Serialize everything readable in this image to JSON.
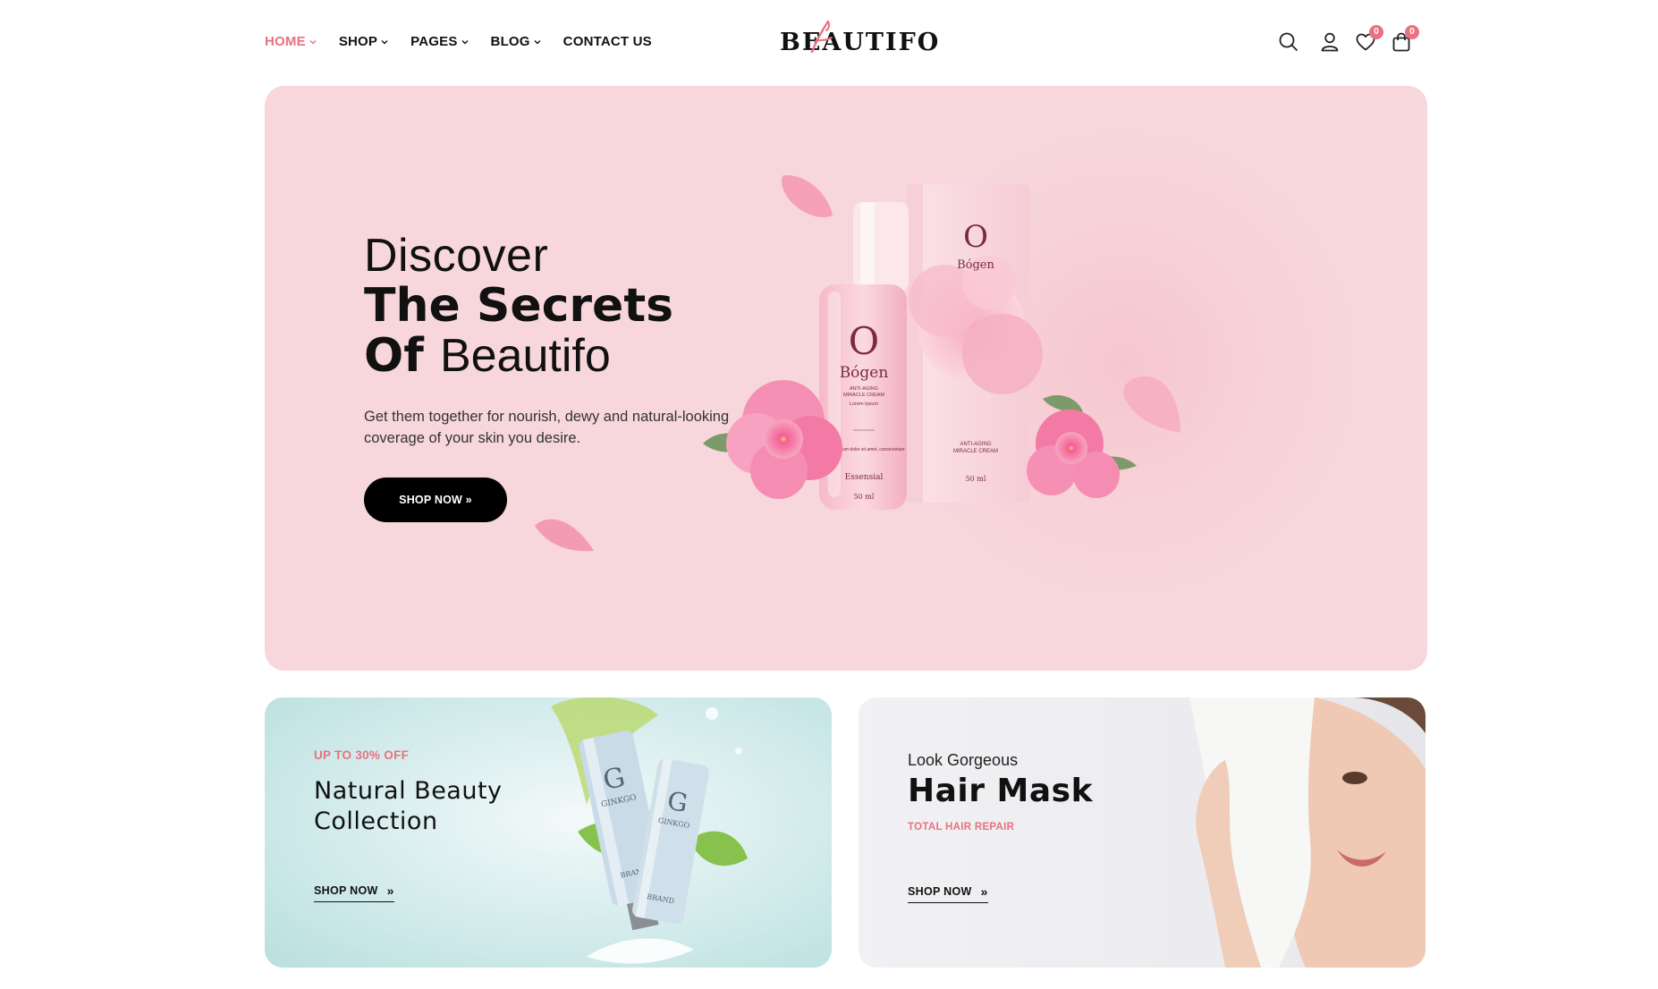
{
  "header": {
    "nav": [
      {
        "label": "HOME",
        "dropdown": true,
        "active": true
      },
      {
        "label": "SHOP",
        "dropdown": true,
        "active": false
      },
      {
        "label": "PAGES",
        "dropdown": true,
        "active": false
      },
      {
        "label": "BLOG",
        "dropdown": true,
        "active": false
      },
      {
        "label": "CONTACT US",
        "dropdown": false,
        "active": false
      }
    ],
    "logo": "BEAUTIFO",
    "wishlist_count": "0",
    "cart_count": "0",
    "icons": [
      "search-icon",
      "user-icon",
      "heart-icon",
      "bag-icon"
    ]
  },
  "hero": {
    "title_line1": "Discover",
    "title_line2": "The Secrets",
    "title_line3_bold": "Of",
    "title_line3_regular": "Beautifo",
    "description": "Get them together for nourish, dewy and natural-looking coverage of your skin you desire.",
    "cta": "SHOP NOW »",
    "product_brand": "Bógen",
    "product_letter": "O",
    "product_line1": "ANTI-AGING",
    "product_line2": "MIRACLE CREAM",
    "product_sub": "Lorem Ipsum",
    "product_fine": "Lorem ipsum dolor sit amet, consectetuer",
    "product_range": "Essensial",
    "product_volume": "50 ml"
  },
  "promos": [
    {
      "tag": "UP TO 30% OFF",
      "title_line1": "Natural Beauty",
      "title_line2": "Collection",
      "link": "SHOP NOW",
      "product_letter": "G",
      "product_name": "GINKGO",
      "product_brand": "BRAND"
    },
    {
      "kicker": "Look Gorgeous",
      "title": "Hair Mask",
      "tag": "TOTAL HAIR REPAIR",
      "link": "SHOP NOW"
    }
  ],
  "colors": {
    "accent": "#e8727f",
    "hero_bg": "#f7d7dc",
    "promo1_bg": "#d9eeee",
    "promo2_bg": "#ececf0"
  }
}
